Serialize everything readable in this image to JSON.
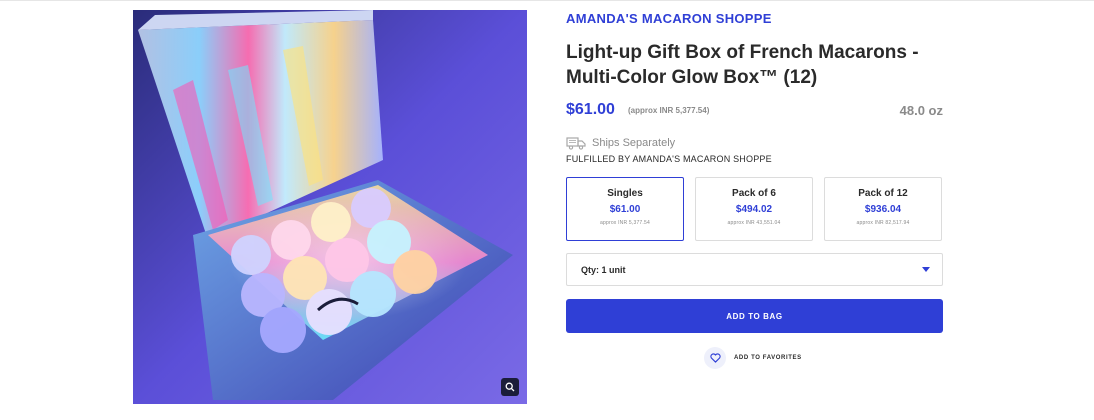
{
  "product": {
    "brand": "AMANDA'S MACARON SHOPPE",
    "title": "Light-up Gift Box of French Macarons - Multi-Color Glow Box™ (12)",
    "price": "$61.00",
    "approx_price": "(approx INR 5,377.54)",
    "weight": "48.0 oz",
    "image_icon": "product-photo",
    "zoom_icon": "magnifier-icon"
  },
  "shipping": {
    "icon": "truck-icon",
    "label": "Ships Separately",
    "fulfilled_by": "FULFILLED BY AMANDA'S MACARON SHOPPE"
  },
  "packs": [
    {
      "name": "Singles",
      "price": "$61.00",
      "approx": "approx INR 5,377.54",
      "selected": true
    },
    {
      "name": "Pack of 6",
      "price": "$494.02",
      "approx": "approx INR 43,551.04",
      "selected": false
    },
    {
      "name": "Pack of 12",
      "price": "$936.04",
      "approx": "approx INR 82,517.94",
      "selected": false
    }
  ],
  "quantity": {
    "label": "Qty: 1 unit"
  },
  "actions": {
    "add_to_bag": "ADD TO BAG",
    "add_to_favorites": "ADD TO FAVORITES",
    "favorites_icon": "heart-icon"
  },
  "colors": {
    "accent": "#2f3fd6",
    "muted_text": "#8a8a8a"
  }
}
